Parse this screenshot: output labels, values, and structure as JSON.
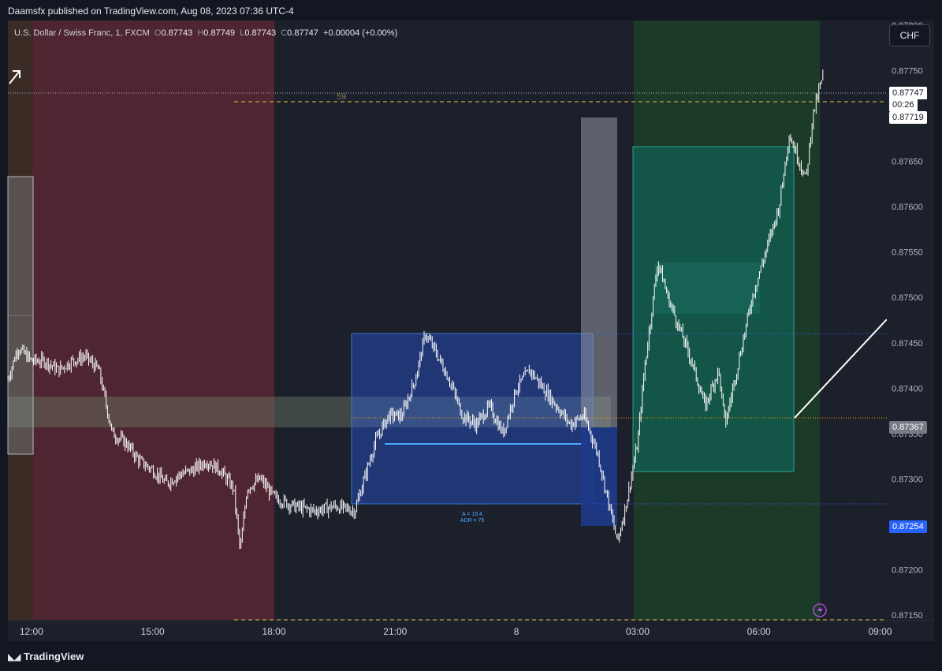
{
  "header": {
    "published": "Daamsfx published on TradingView.com, Aug 08, 2023 07:36 UTC-4"
  },
  "legend": {
    "symbol": "U.S. Dollar / Swiss Franc, 1, FXCM",
    "open_label": "O",
    "open": "0.87743",
    "high_label": "H",
    "high": "0.87749",
    "low_label": "L",
    "low": "0.87743",
    "close_label": "C",
    "close": "0.87747",
    "change": "+0.00004 (+0.00%)"
  },
  "currency_button": "CHF",
  "brand": "TradingView",
  "price_tags": {
    "last": "0.87747",
    "countdown": "00:26",
    "level_upper": "0.87719",
    "level_mid": "0.87367",
    "level_low": "0.87254"
  },
  "annotations": {
    "level_label": "59",
    "range_a": "A = 19.4",
    "range_adr": "ADR = 75"
  },
  "colors": {
    "background": "#131722",
    "red_session": "#5a2731",
    "green_session": "#1d3b2b",
    "blue_box": "#2962ff",
    "teal_box": "#26a69a",
    "candle": "#ffffff",
    "accent_blue": "#2962ff",
    "dashed_level": "#e6c74c"
  },
  "chart_data": {
    "type": "line",
    "title": "",
    "xlabel": "",
    "ylabel": "",
    "ylim": [
      0.87145,
      0.87805
    ],
    "x_range": [
      "2023-08-07T11:25",
      "2023-08-08T09:10"
    ],
    "x_ticks": [
      "12:00",
      "15:00",
      "18:00",
      "21:00",
      "8",
      "03:00",
      "06:00",
      "09:00"
    ],
    "y_ticks": [
      "0.87800",
      "0.87750",
      "0.87700",
      "0.87650",
      "0.87600",
      "0.87550",
      "0.87500",
      "0.87450",
      "0.87400",
      "0.87350",
      "0.87300",
      "0.87250",
      "0.87200",
      "0.87150"
    ],
    "series": [
      {
        "x": [
          "2023-08-07T11:25",
          "2023-08-07T11:40",
          "2023-08-07T12:00",
          "2023-08-07T12:20",
          "2023-08-07T12:40",
          "2023-08-07T13:00",
          "2023-08-07T13:20",
          "2023-08-07T13:40",
          "2023-08-07T14:00",
          "2023-08-07T14:20",
          "2023-08-07T14:40",
          "2023-08-07T15:00",
          "2023-08-07T15:20",
          "2023-08-07T15:40",
          "2023-08-07T16:00",
          "2023-08-07T16:20",
          "2023-08-07T16:40",
          "2023-08-07T17:00",
          "2023-08-07T17:10",
          "2023-08-07T17:20",
          "2023-08-07T17:40",
          "2023-08-07T18:00",
          "2023-08-07T18:30",
          "2023-08-07T19:00",
          "2023-08-07T19:30",
          "2023-08-07T20:00",
          "2023-08-07T20:10",
          "2023-08-07T20:30",
          "2023-08-07T20:50",
          "2023-08-07T21:10",
          "2023-08-07T21:30",
          "2023-08-07T21:45",
          "2023-08-07T22:00",
          "2023-08-07T22:20",
          "2023-08-07T22:40",
          "2023-08-07T23:00",
          "2023-08-07T23:20",
          "2023-08-07T23:40",
          "2023-08-08T00:00",
          "2023-08-08T00:20",
          "2023-08-08T00:40",
          "2023-08-08T01:00",
          "2023-08-08T01:20",
          "2023-08-08T01:40",
          "2023-08-08T02:00",
          "2023-08-08T02:15",
          "2023-08-08T02:30",
          "2023-08-08T02:45",
          "2023-08-08T03:00",
          "2023-08-08T03:10",
          "2023-08-08T03:30",
          "2023-08-08T03:45",
          "2023-08-08T04:00",
          "2023-08-08T04:20",
          "2023-08-08T04:40",
          "2023-08-08T05:00",
          "2023-08-08T05:10",
          "2023-08-08T05:30",
          "2023-08-08T05:50",
          "2023-08-08T06:10",
          "2023-08-08T06:30",
          "2023-08-08T06:45",
          "2023-08-08T07:00",
          "2023-08-08T07:10",
          "2023-08-08T07:20",
          "2023-08-08T07:30",
          "2023-08-08T07:36"
        ],
        "y": [
          0.8741,
          0.87445,
          0.8743,
          0.8743,
          0.8742,
          0.8743,
          0.87435,
          0.8742,
          0.8735,
          0.8734,
          0.8732,
          0.8731,
          0.87295,
          0.87305,
          0.8731,
          0.8732,
          0.8731,
          0.8729,
          0.8722,
          0.8729,
          0.873,
          0.8728,
          0.8727,
          0.87265,
          0.8727,
          0.87265,
          0.8729,
          0.8734,
          0.8737,
          0.8737,
          0.8741,
          0.8746,
          0.8744,
          0.8741,
          0.8737,
          0.8736,
          0.8738,
          0.8735,
          0.874,
          0.8742,
          0.874,
          0.8738,
          0.8736,
          0.8737,
          0.8733,
          0.8728,
          0.8723,
          0.8728,
          0.8734,
          0.8742,
          0.8754,
          0.875,
          0.8747,
          0.8743,
          0.8738,
          0.8742,
          0.8736,
          0.8743,
          0.875,
          0.8755,
          0.876,
          0.8768,
          0.8765,
          0.8763,
          0.877,
          0.8773,
          0.87747
        ]
      }
    ],
    "levels": [
      {
        "price": 0.87719,
        "style": "dashed"
      },
      {
        "price": 0.8715,
        "style": "dashed"
      },
      {
        "price": 0.87367,
        "style": "dotted"
      },
      {
        "price": 0.8747,
        "style": "dotted"
      },
      {
        "price": 0.87279,
        "style": "dotted"
      },
      {
        "price": 0.87747,
        "style": "dotted"
      }
    ],
    "zones": [
      {
        "kind": "session-red",
        "x0": "2023-08-07T11:25",
        "x1": "2023-08-07T18:00"
      },
      {
        "kind": "session-green",
        "x0": "2023-08-08T03:00",
        "x1": "2023-08-08T07:36"
      },
      {
        "kind": "range-box",
        "x0": "2023-08-07T20:00",
        "x1": "2023-08-08T01:50",
        "y0": 0.8728,
        "y1": 0.87472
      },
      {
        "kind": "teal-box",
        "x0": "2023-08-08T03:00",
        "x1": "2023-08-08T07:00",
        "y0": 0.87315,
        "y1": 0.87688
      },
      {
        "kind": "grey-band",
        "x0": "2023-08-07T11:25",
        "x1": "2023-08-08T02:30",
        "y0": 0.87365,
        "y1": 0.87402
      }
    ]
  }
}
